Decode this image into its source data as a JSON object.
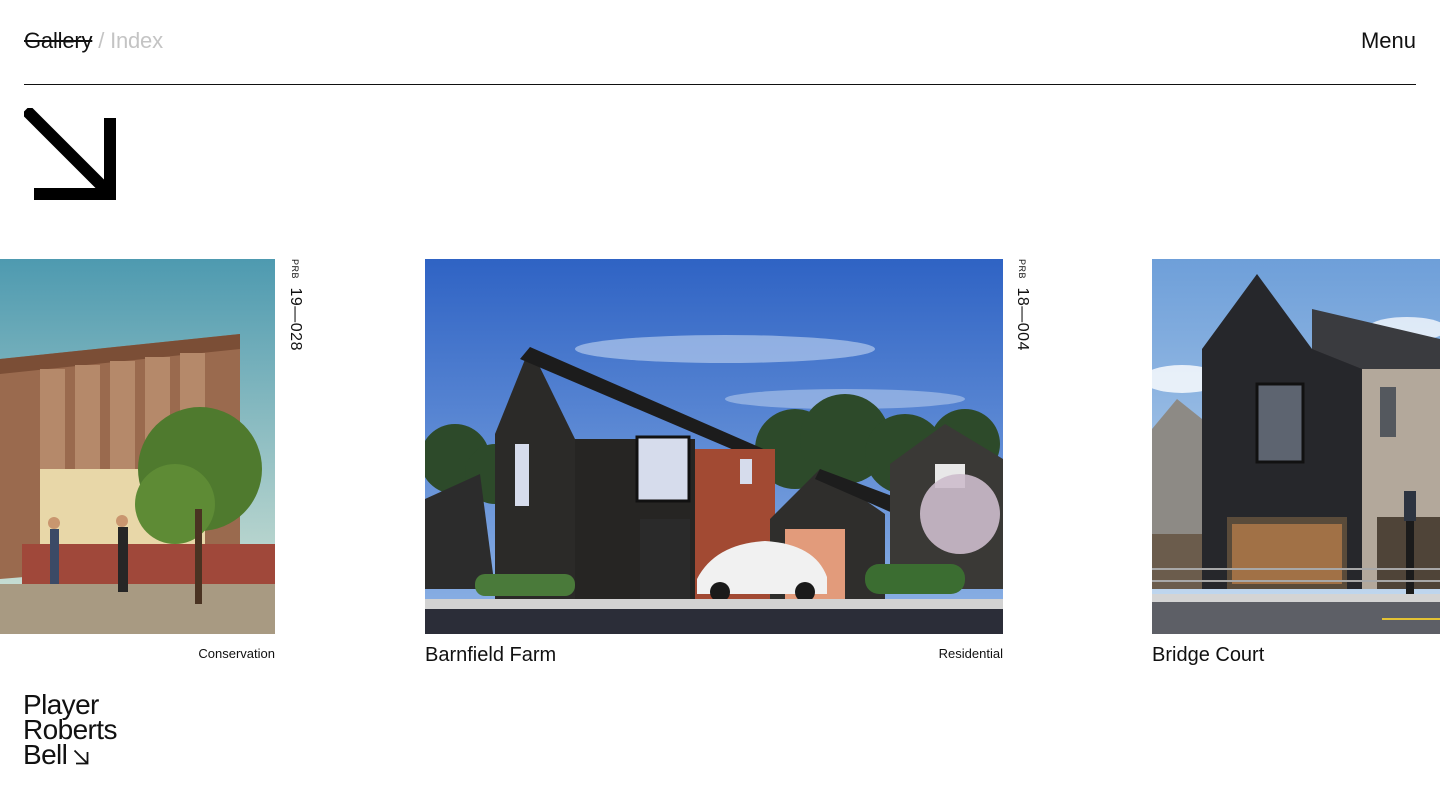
{
  "header": {
    "nav_active": "Gallery",
    "nav_separator": "/",
    "nav_inactive": "Index",
    "menu_label": "Menu"
  },
  "projects": [
    {
      "code_prefix": "PRB",
      "code": "19—028",
      "category": "Conservation"
    },
    {
      "code_prefix": "PRB",
      "code": "18—004",
      "category": "Residential",
      "title": "Barnfield Farm"
    },
    {
      "title": "Bridge Court"
    }
  ],
  "logo": {
    "line1": "Player",
    "line2": "Roberts",
    "line3": "Bell"
  },
  "colors": {
    "text": "#111111",
    "muted": "#c4c4c4",
    "background": "#ffffff"
  },
  "icons": {
    "hero": "arrow-down-right-icon",
    "logo": "arrow-down-right-icon"
  }
}
